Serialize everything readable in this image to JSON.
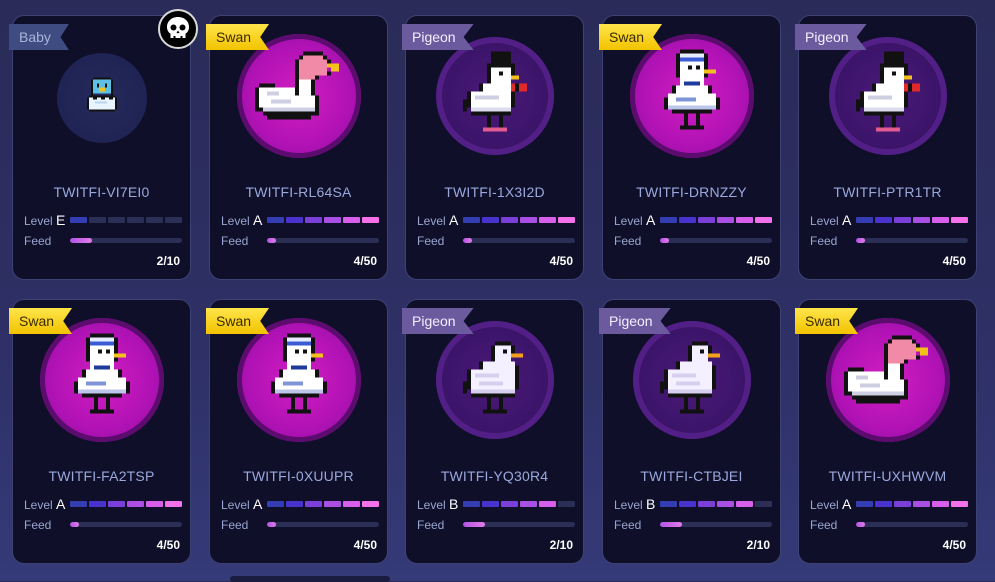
{
  "colors": {
    "swan_tag": "#f2c300",
    "pigeon_tag": "#6b5a9e",
    "baby_tag": "#3e4c82",
    "level_fill_start": "#5a5fae",
    "level_fill_end": "#ef79e4",
    "feed_fill": "#e37be8",
    "card_bg": "#0f0f2a"
  },
  "skull_badge": {
    "icon": "skull-icon"
  },
  "cards": [
    {
      "tag": "Baby",
      "type": "baby",
      "sprite": "baby-bird-icon",
      "name": "TWITFI-VI7EI0",
      "level_label": "Level",
      "grade": "E",
      "level_segments": 6,
      "level_filled": 1,
      "feed_label": "Feed",
      "feed_fraction": 0.2,
      "count": "2/10"
    },
    {
      "tag": "Swan",
      "type": "swan",
      "sprite": "swan-pink-icon",
      "name": "TWITFI-RL64SA",
      "level_label": "Level",
      "grade": "A",
      "level_segments": 6,
      "level_filled": 6,
      "feed_label": "Feed",
      "feed_fraction": 0.08,
      "count": "4/50"
    },
    {
      "tag": "Pigeon",
      "type": "pigeon",
      "sprite": "pigeon-tophat-icon",
      "name": "TWITFI-1X3I2D",
      "level_label": "Level",
      "grade": "A",
      "level_segments": 6,
      "level_filled": 6,
      "feed_label": "Feed",
      "feed_fraction": 0.08,
      "count": "4/50"
    },
    {
      "tag": "Swan",
      "type": "swan",
      "sprite": "goose-sailor-icon",
      "name": "TWITFI-DRNZZY",
      "level_label": "Level",
      "grade": "A",
      "level_segments": 6,
      "level_filled": 6,
      "feed_label": "Feed",
      "feed_fraction": 0.08,
      "count": "4/50"
    },
    {
      "tag": "Pigeon",
      "type": "pigeon",
      "sprite": "pigeon-tophat-icon",
      "name": "TWITFI-PTR1TR",
      "level_label": "Level",
      "grade": "A",
      "level_segments": 6,
      "level_filled": 6,
      "feed_label": "Feed",
      "feed_fraction": 0.08,
      "count": "4/50"
    },
    {
      "tag": "Swan",
      "type": "swan",
      "sprite": "goose-sailor-icon",
      "name": "TWITFI-FA2TSP",
      "level_label": "Level",
      "grade": "A",
      "level_segments": 6,
      "level_filled": 6,
      "feed_label": "Feed",
      "feed_fraction": 0.08,
      "count": "4/50"
    },
    {
      "tag": "Swan",
      "type": "swan",
      "sprite": "goose-sailor-icon",
      "name": "TWITFI-0XUUPR",
      "level_label": "Level",
      "grade": "A",
      "level_segments": 6,
      "level_filled": 6,
      "feed_label": "Feed",
      "feed_fraction": 0.08,
      "count": "4/50"
    },
    {
      "tag": "Pigeon",
      "type": "pigeon",
      "sprite": "pigeon-plain-icon",
      "name": "TWITFI-YQ30R4",
      "level_label": "Level",
      "grade": "B",
      "level_segments": 6,
      "level_filled": 5,
      "feed_label": "Feed",
      "feed_fraction": 0.2,
      "count": "2/10"
    },
    {
      "tag": "Pigeon",
      "type": "pigeon",
      "sprite": "pigeon-plain-icon",
      "name": "TWITFI-CTBJEI",
      "level_label": "Level",
      "grade": "B",
      "level_segments": 6,
      "level_filled": 5,
      "feed_label": "Feed",
      "feed_fraction": 0.2,
      "count": "2/10"
    },
    {
      "tag": "Swan",
      "type": "swan",
      "sprite": "swan-pink-icon",
      "name": "TWITFI-UXHWVM",
      "level_label": "Level",
      "grade": "A",
      "level_segments": 6,
      "level_filled": 6,
      "feed_label": "Feed",
      "feed_fraction": 0.08,
      "count": "4/50"
    }
  ]
}
